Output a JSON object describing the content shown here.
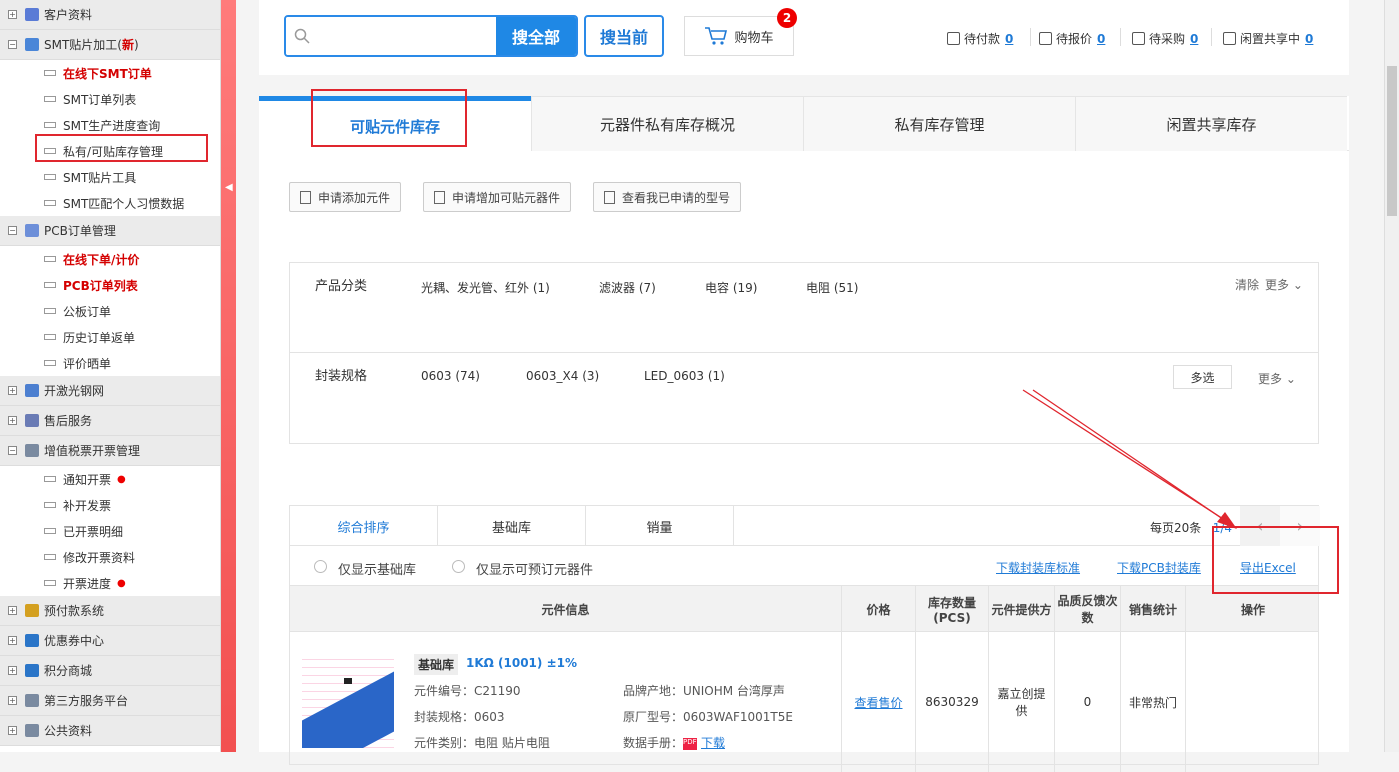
{
  "sidebar": {
    "groups": [
      {
        "label": "客户资料",
        "icon": "user-icon",
        "items": []
      },
      {
        "label": "SMT贴片加工(",
        "new": "新",
        "close": ")",
        "icon": "chip-icon",
        "items": [
          {
            "label": "在线下SMT订单",
            "red": true
          },
          {
            "label": "SMT订单列表"
          },
          {
            "label": "SMT生产进度查询"
          },
          {
            "label": "私有/可贴库存管理"
          },
          {
            "label": "SMT贴片工具"
          },
          {
            "label": "SMT匹配个人习惯数据"
          }
        ]
      },
      {
        "label": "PCB订单管理",
        "icon": "board-icon",
        "items": [
          {
            "label": "在线下单/计价",
            "red": true
          },
          {
            "label": "PCB订单列表",
            "red": true
          },
          {
            "label": "公板订单"
          },
          {
            "label": "历史订单返单"
          },
          {
            "label": "评价晒单"
          }
        ]
      },
      {
        "label": "开激光钢网",
        "icon": "laser-icon",
        "items": []
      },
      {
        "label": "售后服务",
        "icon": "service-icon",
        "items": []
      },
      {
        "label": "增值税票开票管理",
        "icon": "invoice-icon",
        "items": [
          {
            "label": "通知开票",
            "dot": true
          },
          {
            "label": "补开发票"
          },
          {
            "label": "已开票明细"
          },
          {
            "label": "修改开票资料"
          },
          {
            "label": "开票进度",
            "dot": true
          }
        ]
      },
      {
        "label": "预付款系统",
        "icon": "prepay-icon",
        "items": []
      },
      {
        "label": "优惠券中心",
        "icon": "coupon-icon",
        "items": []
      },
      {
        "label": "积分商城",
        "icon": "points-icon",
        "items": []
      },
      {
        "label": "第三方服务平台",
        "icon": "platform-icon",
        "items": []
      },
      {
        "label": "公共资料",
        "icon": "folder-icon",
        "items": []
      }
    ]
  },
  "topbar": {
    "search_placeholder": "",
    "search_all": "搜全部",
    "search_current": "搜当前",
    "cart_label": "购物车",
    "cart_count": "2",
    "stats": [
      {
        "label": "待付款",
        "value": "0"
      },
      {
        "label": "待报价",
        "value": "0"
      },
      {
        "label": "待采购",
        "value": "0"
      },
      {
        "label": "闲置共享中",
        "value": "0"
      }
    ]
  },
  "tabs": [
    "可贴元件库存",
    "元器件私有库存概况",
    "私有库存管理",
    "闲置共享库存"
  ],
  "actions": [
    "申请添加元件",
    "申请增加可贴元器件",
    "查看我已申请的型号"
  ],
  "filters": {
    "category_label": "产品分类",
    "categories": [
      "光耦、发光管、红外 (1)",
      "滤波器 (7)",
      "电容 (19)",
      "电阻 (51)"
    ],
    "clear": "清除",
    "more": "更多",
    "package_label": "封装规格",
    "packages": [
      "0603 (74)",
      "0603_X4 (3)",
      "LED_0603 (1)"
    ],
    "multi": "多选"
  },
  "sortbar": {
    "sorts": [
      "综合排序",
      "基础库",
      "销量"
    ],
    "per_page": "每页20条",
    "page": "1/4"
  },
  "options": {
    "only_basic": "仅显示基础库",
    "only_preorder": "仅显示可预订元器件",
    "dl_std": "下载封装库标准",
    "dl_pcb": "下载PCB封装库",
    "export": "导出Excel"
  },
  "table": {
    "headers": [
      "元件信息",
      "价格",
      "库存数量(PCS)",
      "元件提供方",
      "品质反馈次数",
      "销售统计",
      "操作"
    ],
    "row": {
      "tag": "基础库",
      "name": "1KΩ (1001) ±1%",
      "code": "元件编号：C21190",
      "brand": "品牌产地：UNIOHM 台湾厚声",
      "package": "封装规格：0603",
      "mfr": "原厂型号：0603WAF1001T5E",
      "type": "元件类别：电阻 贴片电阻",
      "manual": "数据手册：",
      "download": "下载",
      "price": "查看售价",
      "stock": "8630329",
      "provider": "嘉立创提供",
      "feedback": "0",
      "sales": "非常热门"
    }
  }
}
